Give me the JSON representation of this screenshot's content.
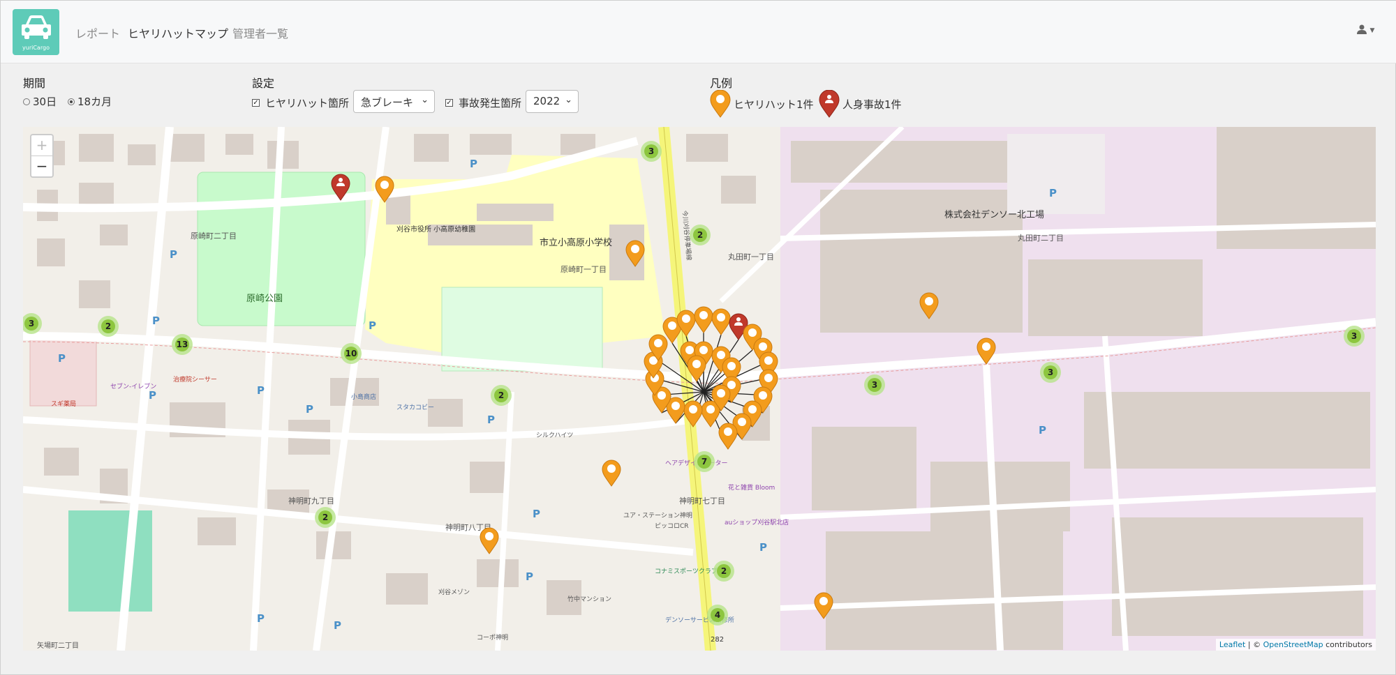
{
  "app": {
    "logo_text": "yuriCargo"
  },
  "nav": {
    "items": [
      "レポート",
      "ヒヤリハットマップ",
      "管理者一覧"
    ],
    "active": "ヒヤリハットマップ"
  },
  "user_menu": {
    "icon": "user-icon"
  },
  "filters": {
    "period": {
      "label": "期間",
      "options": [
        "30日",
        "18カ月"
      ],
      "selected": "18カ月"
    },
    "settings": {
      "label": "設定",
      "nearmiss": {
        "label": "ヒヤリハット箇所",
        "checked": true,
        "select_value": "急ブレーキ"
      },
      "accident": {
        "label": "事故発生箇所",
        "checked": true,
        "select_value": "2022"
      }
    },
    "legend": {
      "label": "凡例",
      "nearmiss": "ヒヤリハット1件",
      "injury": "人身事故1件"
    }
  },
  "map": {
    "zoom_in": "+",
    "zoom_out": "−",
    "attribution": {
      "leaflet": "Leaflet",
      "sep": " | © ",
      "osm": "OpenStreetMap",
      "suffix": " contributors"
    },
    "labels": [
      "原崎町二丁目",
      "原崎公園",
      "刈谷市役所 小高原幼稚園",
      "市立小高原小学校",
      "原崎町一丁目",
      "丸田町一丁目",
      "株式会社デンソー北工場",
      "丸田町二丁目",
      "今川刈谷停車場線",
      "神明町九丁目",
      "神明町八丁目",
      "神明町七丁目",
      "スギ薬局",
      "セブン-イレブン",
      "治療院シーサー",
      "小島商店",
      "スタカコビー",
      "シルクハイツ",
      "ユア・ステーション神明",
      "ピッコロCR",
      "ヘアデザインノーター",
      "花と雑貨 Bloom",
      "auショップ刈谷駅北店",
      "コナミスポーツクラブ刈谷",
      "デンソーサービス研修所",
      "竹中マンション",
      "刈谷メゾン",
      "コーポ神明",
      "矢場町二丁目",
      "282"
    ],
    "clusters": [
      "3",
      "2",
      "3",
      "2",
      "13",
      "10",
      "2",
      "3",
      "3",
      "3",
      "7",
      "2",
      "2",
      "4"
    ],
    "colors": {
      "nearmiss": "#f39c1d",
      "accident": "#c0392b",
      "cluster": "#8dc63f"
    }
  }
}
